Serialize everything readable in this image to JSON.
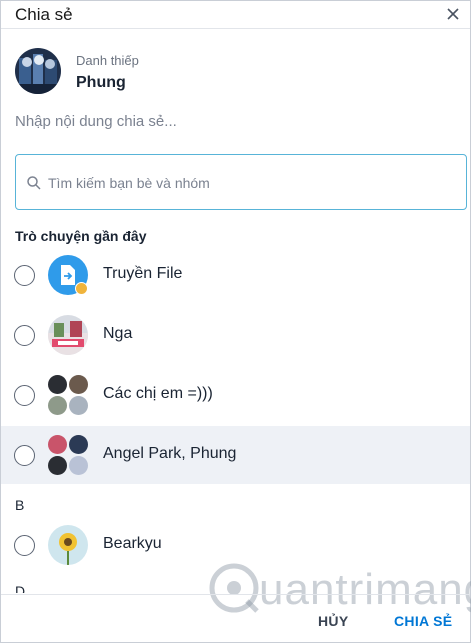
{
  "header": {
    "title": "Chia sẻ"
  },
  "card": {
    "label": "Danh thiếp",
    "name": "Phung"
  },
  "message": {
    "placeholder": "Nhập nội dung chia sẻ..."
  },
  "search": {
    "placeholder": "Tìm kiếm bạn bè và nhóm"
  },
  "sections": {
    "recent": "Trò chuyện gần đây",
    "b": "B",
    "d": "D"
  },
  "conversations": [
    {
      "name": "Truyền File",
      "selected": false
    },
    {
      "name": "Nga",
      "selected": false
    },
    {
      "name": "Các chị em =)))",
      "selected": false
    },
    {
      "name": "Angel Park, Phung",
      "selected": true
    }
  ],
  "contacts_b": [
    {
      "name": "Bearkyu"
    }
  ],
  "footer": {
    "cancel_label": "HỦY",
    "share_label": "CHIA SẺ"
  },
  "watermark": {
    "text": "uantrimang"
  },
  "colors": {
    "accent": "#0077d5",
    "search_border": "#58b4d8",
    "selected_row": "#eef1f6"
  }
}
